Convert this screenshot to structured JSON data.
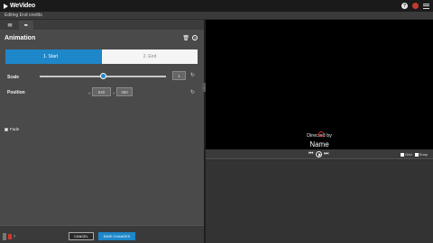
{
  "app": {
    "logo": "WeVideo",
    "subheader": "Editing End credits"
  },
  "panel": {
    "tabs": [
      {
        "icon": "speech-bubble-icon",
        "glyph": "✉"
      },
      {
        "icon": "rocket-icon",
        "glyph": "✒"
      }
    ],
    "title": "Animation",
    "steps": {
      "start": "1. Start",
      "end": "2. End"
    },
    "scale": {
      "label": "Scale",
      "value": "1",
      "slider_fraction": 0.5
    },
    "position": {
      "label": "Position",
      "x_label": "X",
      "x_value": "640",
      "y_label": "Y",
      "y_value": "360"
    },
    "fade": {
      "label": "Fade",
      "checked": false
    }
  },
  "footer": {
    "cancel": "CANCEL",
    "save": "SAVE CHANGES"
  },
  "preview": {
    "small_text": "Directed by",
    "big_text": "Name",
    "grid_label": "Grid",
    "snap_label": "Snap"
  },
  "colors": {
    "accent": "#1e87c9",
    "topbar": "#1a1a1a",
    "panel": "#4a4a4a"
  }
}
